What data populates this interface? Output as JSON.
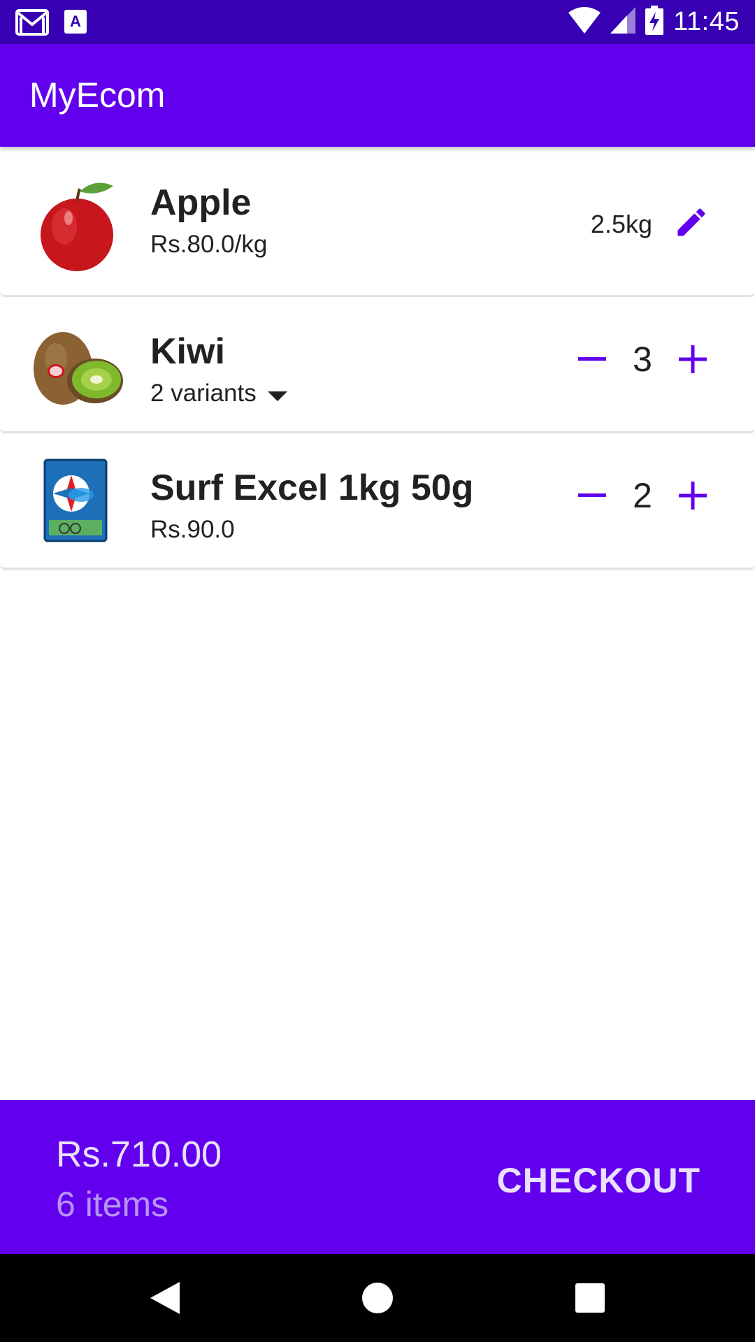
{
  "status_bar": {
    "time": "11:45",
    "left_icons": [
      "gmail-icon",
      "app-notification-icon"
    ],
    "right_icons": [
      "wifi-icon",
      "cell-signal-icon",
      "battery-charging-icon"
    ]
  },
  "app_bar": {
    "title": "MyEcom"
  },
  "cart": {
    "items": [
      {
        "name": "Apple",
        "subtitle": "Rs.80.0/kg",
        "quantity_label": "2.5kg",
        "action_icon": "edit-icon",
        "image_icon": "apple-icon"
      },
      {
        "name": "Kiwi",
        "subtitle": "2 variants",
        "quantity": "3",
        "image_icon": "kiwi-icon"
      },
      {
        "name": "Surf Excel 1kg 50g",
        "subtitle": "Rs.90.0",
        "quantity": "2",
        "image_icon": "detergent-pack-icon"
      }
    ]
  },
  "checkout": {
    "total": "Rs.710.00",
    "item_count": "6 items",
    "button_label": "CHECKOUT"
  },
  "nav_bar": {
    "buttons": [
      "back-icon",
      "home-icon",
      "recents-icon"
    ]
  },
  "colors": {
    "primary": "#6200ee",
    "primary_dark": "#3700b3",
    "accent_text": "#b793f7"
  }
}
